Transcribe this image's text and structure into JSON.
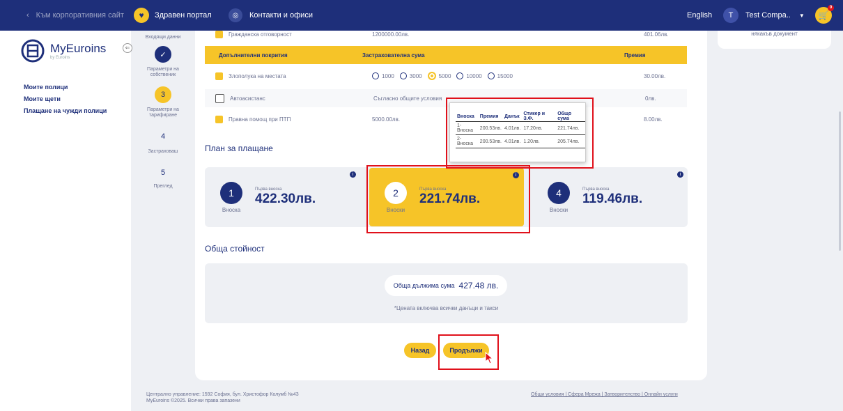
{
  "topbar": {
    "back_label": "Към корпоративния сайт",
    "health_label": "Здравен портал",
    "contacts_label": "Контакти и офиси",
    "language": "English",
    "avatar_initial": "T",
    "user_name": "Test Compa..",
    "cart_count": "0"
  },
  "sidebar": {
    "logo_text": "MyEuroins",
    "logo_sub": "by Euroins",
    "links": [
      "Моите полици",
      "Моите щети",
      "Плащане на чужди полици"
    ]
  },
  "stepper": {
    "steps": [
      {
        "label": "Входящи данни",
        "num": ""
      },
      {
        "label": "Параметри на собственик",
        "num": ""
      },
      {
        "label": "Параметри на тарифиране",
        "num": "3"
      },
      {
        "label": "Застраховаш",
        "num": "4"
      },
      {
        "label": "Преглед",
        "num": "5"
      }
    ]
  },
  "right_card": {
    "text": "някакъв документ"
  },
  "coverage": {
    "top_row": {
      "label": "Гражданска отговорност",
      "sum": "1200000.00лв.",
      "premium": "401.06лв."
    },
    "header": {
      "col1": "Допълнителни покрития",
      "col2": "Застрахователна сума",
      "col3": "Премия"
    },
    "rows": [
      {
        "label": "Злополука на местата",
        "sum": "",
        "premium": "30.00лв."
      },
      {
        "label": "Автоасистанс",
        "sum": "Съгласно общите условия",
        "premium": "0лв."
      },
      {
        "label": "Правна помощ при ПТП",
        "sum": "5000.00лв.",
        "premium": "8.00лв."
      }
    ],
    "radio_options": [
      "1000",
      "3000",
      "5000",
      "10000",
      "15000"
    ]
  },
  "payment": {
    "title": "План за плащане",
    "plans": [
      {
        "num": "1",
        "sub": "Вноска",
        "first_label": "Първа вноска",
        "price": "422.30лв."
      },
      {
        "num": "2",
        "sub": "Вноски",
        "first_label": "Първа вноска",
        "price": "221.74лв."
      },
      {
        "num": "4",
        "sub": "Вноски",
        "first_label": "Първа вноска",
        "price": "119.46лв."
      }
    ]
  },
  "popup": {
    "headers": [
      "Вноска",
      "Премия",
      "Данък",
      "Стикер и З.Ф.",
      "Общо сума"
    ],
    "rows": [
      [
        "1-Вноска",
        "200.53лв.",
        "4.01лв.",
        "17.20лв.",
        "221.74лв."
      ],
      [
        "2-Вноска",
        "200.53лв.",
        "4.01лв.",
        "1.20лв.",
        "205.74лв."
      ]
    ]
  },
  "total": {
    "title": "Обща стойност",
    "label": "Обща дължима сума",
    "amount": "427.48 лв.",
    "note": "*Цената включва всички данъци и такси"
  },
  "buttons": {
    "back": "Назад",
    "continue": "Продължи"
  },
  "footer": {
    "address": "Централно управление: 1592 София, бул. Христофор Колумб №43",
    "copyright": "MyEuroins ©2025. Всички права запазени",
    "links": "Общи условия | Сфера Мрежа | Затворителство | Онлайн услуги"
  },
  "colors": {
    "navy": "#1e2f7a",
    "yellow": "#f6c428",
    "highlight": "#e0111b"
  }
}
